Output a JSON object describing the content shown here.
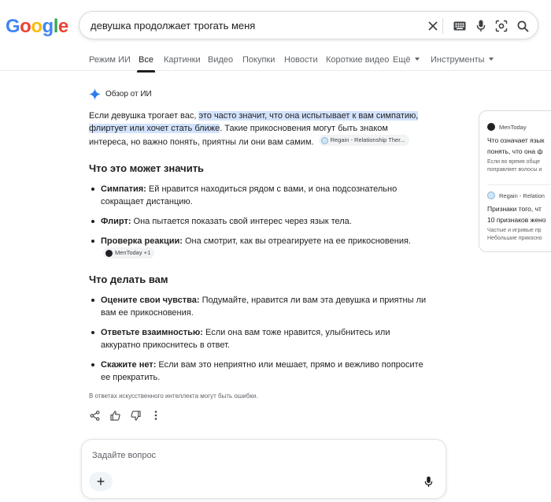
{
  "logo": [
    "G",
    "o",
    "o",
    "g",
    "l",
    "e"
  ],
  "logo_colors": [
    "#4285f4",
    "#ea4335",
    "#fbbc05",
    "#4285f4",
    "#34a853",
    "#ea4335"
  ],
  "search": {
    "query": "девушка продолжает трогать меня"
  },
  "icons": {
    "clear": "close-icon",
    "keyboard": "keyboard-icon",
    "voice": "mic-icon",
    "lens": "lens-icon",
    "search": "search-icon"
  },
  "tabs": [
    {
      "label": "Режим ИИ"
    },
    {
      "label": "Все"
    },
    {
      "label": "Картинки"
    },
    {
      "label": "Видео"
    },
    {
      "label": "Покупки"
    },
    {
      "label": "Новости"
    },
    {
      "label": "Короткие видео"
    },
    {
      "label": "Ещё"
    },
    {
      "label": "Инструменты"
    }
  ],
  "overview": {
    "header": "Обзор от ИИ",
    "intro": {
      "part1": "Если девушка трогает вас, ",
      "highlight": "это часто значит, что она испытывает к вам симпатию, флиртует или хочет стать ближе",
      "part2": ". Такие прикосновения могут быть знаком интереса, но важно понять, приятны ли они вам самим.",
      "chip": "Regain - Relationship Ther..."
    },
    "section1": {
      "title": "Что это может значить",
      "items": [
        {
          "bold": "Симпатия:",
          "text": " Ей нравится находиться рядом с вами, и она подсознательно сокращает дистанцию."
        },
        {
          "bold": "Флирт:",
          "text": " Она пытается показать свой интерес через язык тела."
        },
        {
          "bold": "Проверка реакции:",
          "text": " Она смотрит, как вы отреагируете на ее прикосновения.",
          "chip": "MenToday +1"
        }
      ]
    },
    "section2": {
      "title": "Что делать вам",
      "items": [
        {
          "bold": "Оцените свои чувства:",
          "text": " Подумайте, нравится ли вам эта девушка и приятны ли вам ее прикосновения."
        },
        {
          "bold": "Ответьте взаимностью:",
          "text": " Если она вам тоже нравится, улыбнитесь или аккуратно прикоснитесь в ответ."
        },
        {
          "bold": "Скажите нет:",
          "text": " Если вам это неприятно или мешает, прямо и вежливо попросите ее прекратить."
        }
      ]
    },
    "disclaimer": "В ответах искусственного интеллекта могут быть ошибки."
  },
  "ask": {
    "placeholder": "Задайте вопрос",
    "plus": "+"
  },
  "sources": [
    {
      "name": "MenToday",
      "title1": "Что означает язык",
      "title2": "понять, что она ф",
      "snip1": "Если во время обще",
      "snip2": "поправляет волосы и"
    },
    {
      "name": "Regain - Relation",
      "title1": "Признаки того, чт",
      "title2": "10 признаков жено",
      "snip1": "Частые и игривые пр",
      "snip2": "Небольшие прикосно"
    }
  ]
}
